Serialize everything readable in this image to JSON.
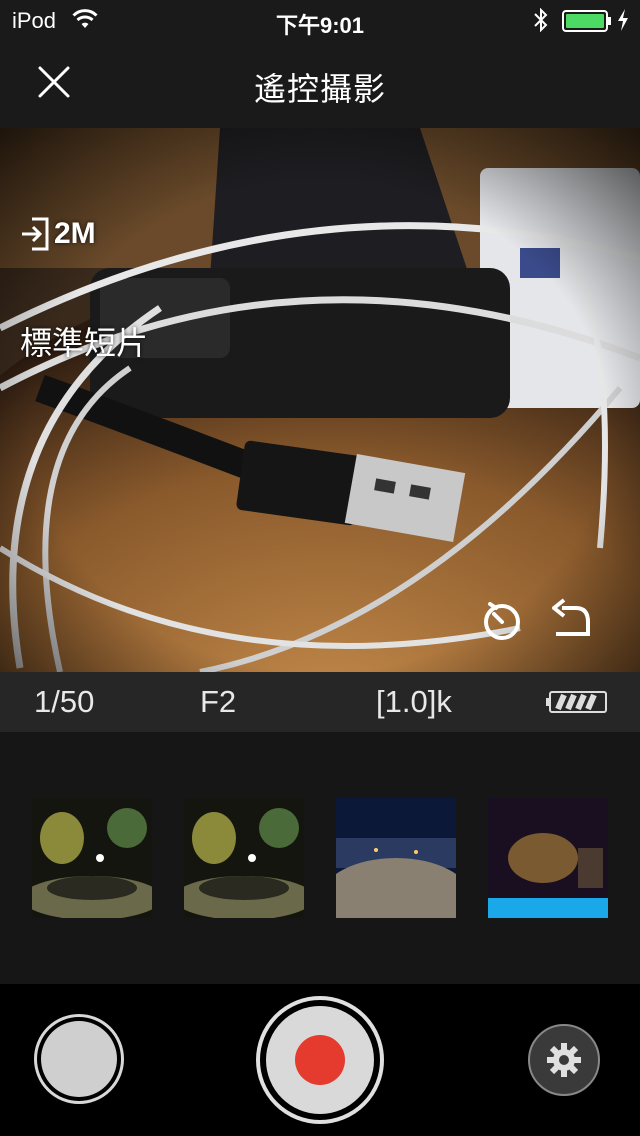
{
  "status_bar": {
    "carrier": "iPod",
    "time": "下午9:01",
    "icons": [
      "wifi-icon",
      "bluetooth-icon",
      "battery-icon",
      "charging-icon"
    ]
  },
  "nav": {
    "title": "遙控攝影",
    "close_icon": "close-icon"
  },
  "preview": {
    "resolution_label": "2M",
    "resolution_icon": "import-icon",
    "mode_label": "標準短片",
    "icons": [
      "self-timer-icon",
      "rotate-back-icon"
    ]
  },
  "info_bar": {
    "shutter_speed": "1/50",
    "aperture": "F2",
    "white_balance": "[1.0]k",
    "camera_battery_icon": "camera-battery-icon"
  },
  "thumbnails": [
    {
      "name": "thumbnail-1",
      "colors": [
        "#1c1c10",
        "#6a6a2a",
        "#2a3a2a"
      ]
    },
    {
      "name": "thumbnail-2",
      "colors": [
        "#1c1c10",
        "#6a6a2a",
        "#2a3a2a"
      ]
    },
    {
      "name": "thumbnail-3",
      "colors": [
        "#0c1838",
        "#3a4a70",
        "#8a7f72"
      ]
    },
    {
      "name": "thumbnail-4",
      "colors": [
        "#1a0f20",
        "#5a4030",
        "#1aa8e8"
      ]
    }
  ],
  "controls": {
    "left_button": "photo-shutter-button",
    "center_button": "record-button",
    "right_button": "settings-button",
    "record_color": "#e53a2e"
  }
}
